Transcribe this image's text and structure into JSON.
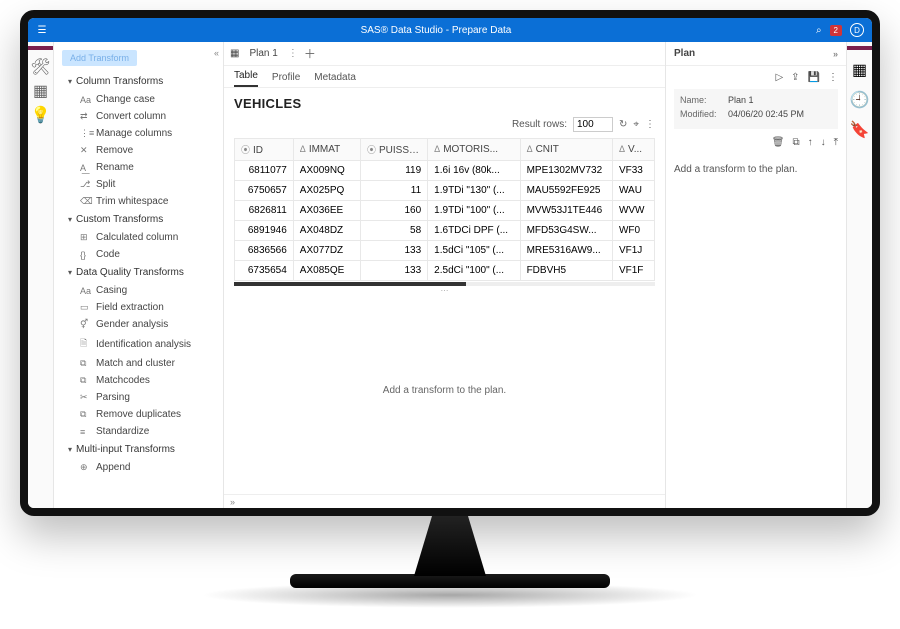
{
  "titlebar": {
    "title": "SAS® Data Studio - Prepare Data",
    "notif_count": "2",
    "avatar_letter": "D"
  },
  "sidebar": {
    "add_label": "Add Transform",
    "groups": [
      {
        "label": "Column Transforms",
        "items": [
          {
            "icon": "Aa",
            "label": "Change case"
          },
          {
            "icon": "⇄",
            "label": "Convert column"
          },
          {
            "icon": "⋮≡",
            "label": "Manage columns"
          },
          {
            "icon": "✕",
            "label": "Remove"
          },
          {
            "icon": "A͟",
            "label": "Rename"
          },
          {
            "icon": "⎇",
            "label": "Split"
          },
          {
            "icon": "⌫",
            "label": "Trim whitespace"
          }
        ]
      },
      {
        "label": "Custom Transforms",
        "items": [
          {
            "icon": "⊞",
            "label": "Calculated column"
          },
          {
            "icon": "{}",
            "label": "Code"
          }
        ]
      },
      {
        "label": "Data Quality Transforms",
        "items": [
          {
            "icon": "Aa",
            "label": "Casing"
          },
          {
            "icon": "▭",
            "label": "Field extraction"
          },
          {
            "icon": "⚥",
            "label": "Gender analysis"
          },
          {
            "icon": "🗎",
            "label": "Identification analysis"
          },
          {
            "icon": "⧉",
            "label": "Match and cluster"
          },
          {
            "icon": "⧉",
            "label": "Matchcodes"
          },
          {
            "icon": "✂",
            "label": "Parsing"
          },
          {
            "icon": "⧉",
            "label": "Remove duplicates"
          },
          {
            "icon": "≡",
            "label": "Standardize"
          }
        ]
      },
      {
        "label": "Multi-input Transforms",
        "items": [
          {
            "icon": "⊕",
            "label": "Append"
          }
        ]
      }
    ]
  },
  "main": {
    "plan_tab": "Plan 1",
    "subtabs": {
      "table": "Table",
      "profile": "Profile",
      "metadata": "Metadata"
    },
    "table_title": "VEHICLES",
    "result_rows_label": "Result rows:",
    "result_rows_value": "100",
    "columns": [
      {
        "icon": "⦿",
        "label": "ID"
      },
      {
        "icon": "Δ",
        "label": "IMMAT"
      },
      {
        "icon": "⦿",
        "label": "PUISSANC..."
      },
      {
        "icon": "Δ",
        "label": "MOTORIS..."
      },
      {
        "icon": "Δ",
        "label": "CNIT"
      },
      {
        "icon": "Δ",
        "label": "V..."
      }
    ],
    "rows": [
      [
        "6811077",
        "AX009NQ",
        "119",
        "1.6i 16v (80k...",
        "MPE1302MV732",
        "VF33"
      ],
      [
        "6750657",
        "AX025PQ",
        "11",
        "1.9TDi \"130\" (...",
        "MAU5592FE925",
        "WAU"
      ],
      [
        "6826811",
        "AX036EE",
        "160",
        "1.9TDi \"100\" (...",
        "MVW53J1TE446",
        "WVW"
      ],
      [
        "6891946",
        "AX048DZ",
        "58",
        "1.6TDCi DPF (...",
        "MFD53G4SW...",
        "WF0"
      ],
      [
        "6836566",
        "AX077DZ",
        "133",
        "1.5dCi \"105\" (...",
        "MRE5316AW9...",
        "VF1J"
      ],
      [
        "6735654",
        "AX085QE",
        "133",
        "2.5dCi \"100\" (...",
        "FDBVH5",
        "VF1F"
      ]
    ],
    "placeholder": "Add a transform to the plan."
  },
  "rightpanel": {
    "title": "Plan",
    "meta": {
      "name_k": "Name:",
      "name_v": "Plan 1",
      "mod_k": "Modified:",
      "mod_v": "04/06/20 02:45 PM"
    },
    "placeholder": "Add a transform to the plan."
  }
}
